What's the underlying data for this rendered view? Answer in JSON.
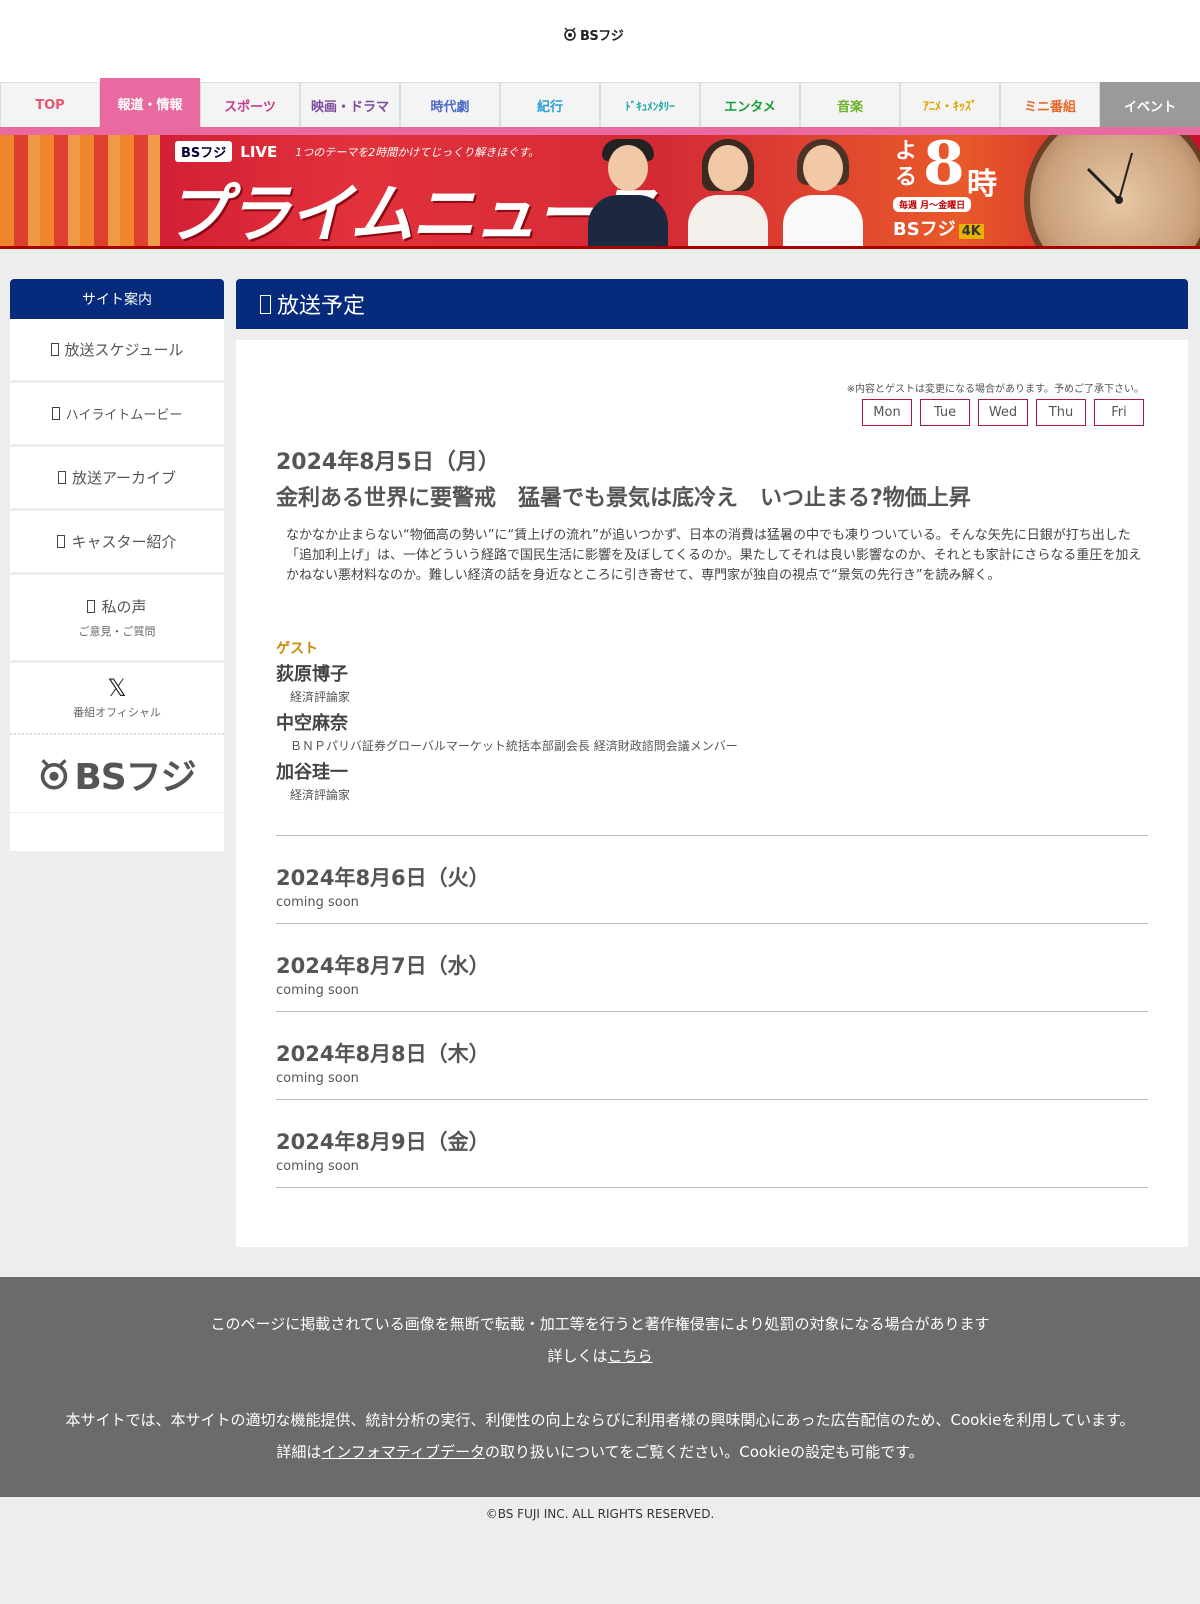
{
  "header": {
    "logo_text": "BSフジ"
  },
  "nav": {
    "tabs": [
      {
        "label": "TOP",
        "color": "#e8566f"
      },
      {
        "label": "報道・情報",
        "color": "#ffffff"
      },
      {
        "label": "スポーツ",
        "color": "#c63b8d"
      },
      {
        "label": "映画・ドラマ",
        "color": "#7a4aa0"
      },
      {
        "label": "時代劇",
        "color": "#4a6ac8"
      },
      {
        "label": "紀行",
        "color": "#2aa0d8"
      },
      {
        "label": "ﾄﾞｷｭﾒﾝﾀﾘｰ",
        "color": "#1fa6a6"
      },
      {
        "label": "エンタメ",
        "color": "#1a9e3c"
      },
      {
        "label": "音楽",
        "color": "#6fb02a"
      },
      {
        "label": "ｱﾆﾒ・ｷｯｽﾞ",
        "color": "#e2a500"
      },
      {
        "label": "ミニ番組",
        "color": "#e8682a"
      },
      {
        "label": "イベント",
        "color": "#ffffff"
      }
    ]
  },
  "banner": {
    "bs_logo": "BSフジ",
    "live": "LIVE",
    "tagline": "1つのテーマを2時間かけてじっくり解きほぐす。",
    "title": "プライムニュース",
    "time_yo": "よる",
    "time_num": "8",
    "time_ji": "時",
    "schedule": "毎週 月～金曜日",
    "channel": "BSフジ",
    "channel_4k": "4K"
  },
  "sidebar": {
    "heading": "サイト案内",
    "items": [
      {
        "label": "放送スケジュール"
      },
      {
        "label": "ハイライトムービー"
      },
      {
        "label": "放送アーカイブ"
      },
      {
        "label": "キャスター紹介"
      }
    ],
    "voice": {
      "label": "私の声",
      "sub": "ご意見・ご質問"
    },
    "x_official": {
      "glyph": "𝕏",
      "label": "番組オフィシャル"
    },
    "logo_text": "BSフジ"
  },
  "main": {
    "heading": "放送予定",
    "notice": "※内容とゲストは変更になる場合があります。予めご了承下さい。",
    "days": [
      "Mon",
      "Tue",
      "Wed",
      "Thu",
      "Fri"
    ],
    "episodes": [
      {
        "date": "2024年8月5日（月）",
        "title": "金利ある世界に要警戒　猛暑でも景気は底冷え　いつ止まる?物価上昇",
        "description": "なかなか止まらない“物価高の勢い”に“賃上げの流れ”が追いつかず、日本の消費は猛暑の中でも凍りついている。そんな矢先に日銀が打ち出した「追加利上げ」は、一体どういう経路で国民生活に影響を及ぼしてくるのか。果たしてそれは良い影響なのか、それとも家計にさらなる重圧を加えかねない悪材料なのか。難しい経済の話を身近なところに引き寄せて、専門家が独自の視点で“景気の先行き”を読み解く。",
        "guest_heading": "ゲスト",
        "guests": [
          {
            "name": "荻原博子",
            "role": "経済評論家"
          },
          {
            "name": "中空麻奈",
            "role": "ＢＮＰパリバ証券グローバルマーケット統括本部副会長 経済財政諮問会議メンバー"
          },
          {
            "name": "加谷珪一",
            "role": "経済評論家"
          }
        ]
      },
      {
        "date": "2024年8月6日（火）",
        "status": "coming soon"
      },
      {
        "date": "2024年8月7日（水）",
        "status": "coming soon"
      },
      {
        "date": "2024年8月8日（木）",
        "status": "coming soon"
      },
      {
        "date": "2024年8月9日（金）",
        "status": "coming soon"
      }
    ]
  },
  "footer": {
    "copyright_notice": "このページに掲載されている画像を無断で転載・加工等を行うと著作権侵害により処罰の対象になる場合があります",
    "details_prefix": "詳しくは",
    "details_link": "こちら",
    "cookie_line1": "本サイトでは、本サイトの適切な機能提供、統計分析の実行、利便性の向上ならびに利用者様の興味関心にあった広告配信のため、Cookieを利用しています。",
    "cookie_prefix": "詳細は",
    "cookie_link": "インフォマティブデータ",
    "cookie_suffix": "の取り扱いについてをご覧ください。Cookieの設定も可能です。",
    "copyright": "©BS FUJI INC. ALL RIGHTS RESERVED."
  },
  "colors": {
    "navy": "#062a7c",
    "pink": "#e86aa1",
    "footer_gray": "#6b6b6b",
    "guest_gold": "#c98a00",
    "day_border": "#b01a3a"
  }
}
